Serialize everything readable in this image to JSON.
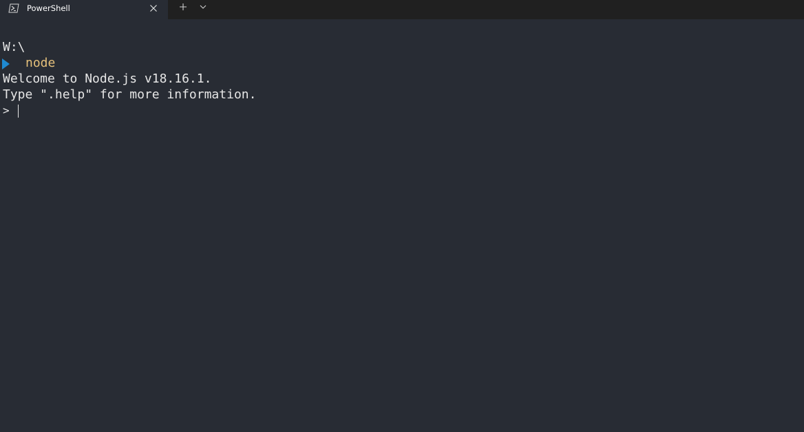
{
  "colors": {
    "terminal_bg": "#282c34",
    "tabbar_bg": "#202020",
    "text": "#e6e6e6",
    "command": "#e5c07b",
    "prompt_arrow": "#1f8ad2"
  },
  "tabs": [
    {
      "title": "PowerShell",
      "icon": "powershell-icon",
      "active": true
    }
  ],
  "tabbar": {
    "new_tab_icon": "plus-icon",
    "dropdown_icon": "chevron-down-icon"
  },
  "terminal": {
    "path": "W:\\",
    "prompt_icon": "chevron-right-icon",
    "command": "node",
    "output": [
      "Welcome to Node.js v18.16.1.",
      "Type \".help\" for more information."
    ],
    "repl_prompt": ">"
  }
}
